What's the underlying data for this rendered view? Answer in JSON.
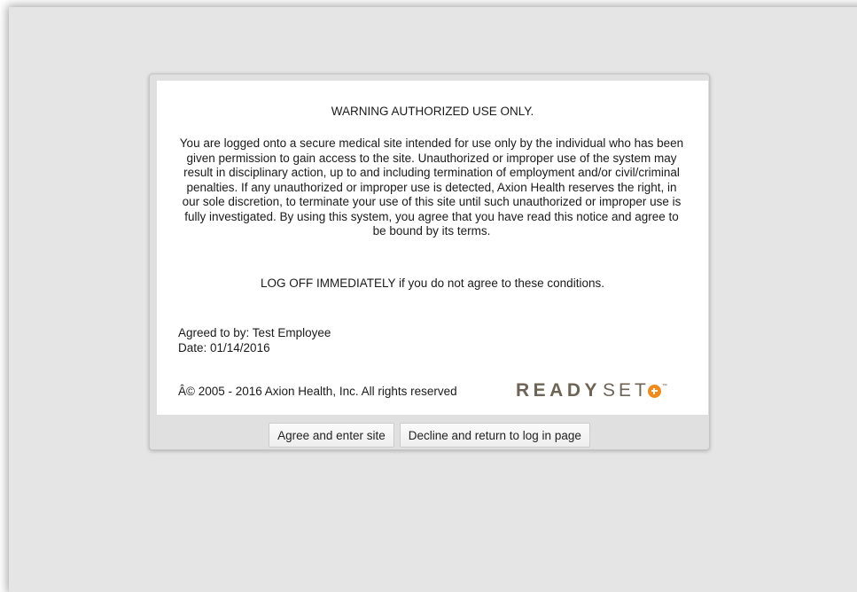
{
  "dialog": {
    "title": "WARNING AUTHORIZED USE ONLY.",
    "notice": "You are logged onto a secure medical site intended for use only by the individual who has been given permission to gain access to the site. Unauthorized or improper use of the system may result in disciplinary action, up to and including termination of employment and/or civil/criminal penalties. If any unauthorized or improper use is detected, Axion Health reserves the right, in our sole discretion, to terminate your use of this site until such unauthorized or improper use is fully investigated. By using this system, you agree that you have read this notice and agree to be bound by its terms.",
    "logoff": "LOG OFF IMMEDIATELY if you do not agree to these conditions.",
    "agreed_by": "Agreed to by: Test Employee",
    "date": "Date: 01/14/2016",
    "copyright": "Â© 2005 - 2016 Axion Health, Inc. All rights reserved",
    "logo": {
      "ready": "READY",
      "set": "SET",
      "tm": "™",
      "mark_color": "#f08a1c",
      "text_color": "#6e6455"
    }
  },
  "buttons": {
    "agree": "Agree and enter site",
    "decline": "Decline and return to log in page"
  }
}
